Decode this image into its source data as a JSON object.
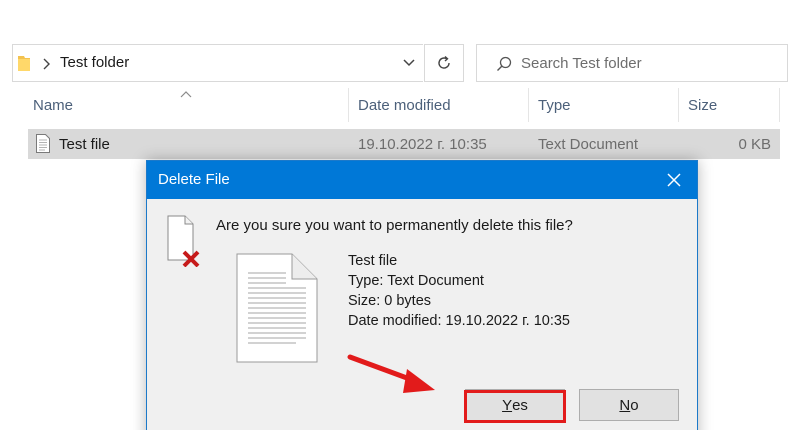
{
  "explorer": {
    "breadcrumb": "Test folder",
    "search_placeholder": "Search Test folder",
    "columns": [
      "Name",
      "Date modified",
      "Type",
      "Size"
    ],
    "file": {
      "name": "Test file",
      "date_modified": "19.10.2022 г. 10:35",
      "type": "Text Document",
      "size": "0 KB"
    },
    "icons": {
      "folder": "folder-icon",
      "chevron": "chevron-right-icon",
      "dropdown": "chevron-down-icon",
      "refresh": "refresh-icon",
      "search": "search-icon",
      "sort": "sort-up-icon",
      "file": "text-document-icon"
    }
  },
  "dialog": {
    "title": "Delete File",
    "question": "Are you sure you want to permanently delete this file?",
    "details": {
      "name": "Test file",
      "type": "Type: Text Document",
      "size": "Size: 0 bytes",
      "date": "Date modified: 19.10.2022 г. 10:35"
    },
    "buttons": {
      "yes_hotkey": "Y",
      "yes_rest": "es",
      "no_hotkey": "N",
      "no_rest": "o"
    },
    "icons": {
      "close": "close-icon",
      "delete": "delete-file-icon",
      "document": "document-icon"
    }
  },
  "annotation": {
    "highlight_color": "#e21b1b",
    "target": "yes-button"
  },
  "colors": {
    "accent": "#0078d7",
    "selection": "#d9d9d9",
    "dialog_bg": "#f0f0f0"
  }
}
